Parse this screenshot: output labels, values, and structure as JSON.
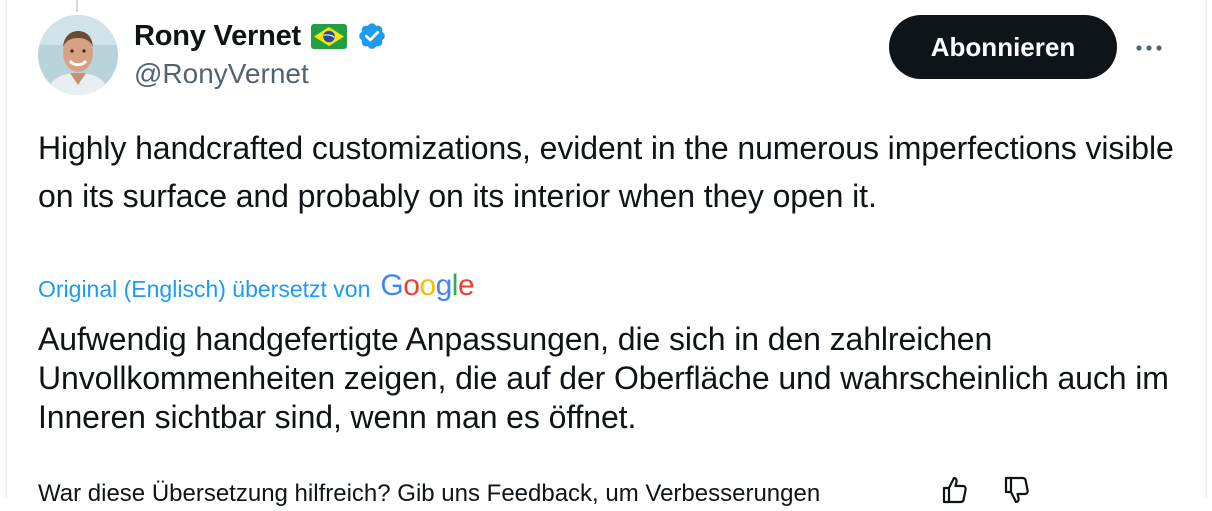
{
  "author": {
    "display_name": "Rony Vernet",
    "handle": "@RonyVernet",
    "avatar_icon": "profile-photo",
    "flag_icon": "brazil-flag-icon",
    "verified_icon": "verified-badge-icon"
  },
  "actions": {
    "follow_label": "Abonnieren",
    "more_icon": "more-horizontal-icon"
  },
  "tweet": {
    "text": "Highly handcrafted customizations, evident in the numerous imperfections visible on its surface and probably on its interior when they open it."
  },
  "translation": {
    "label": "Original (Englisch) übersetzt von",
    "provider_logo": "Google",
    "text": "Aufwendig handgefertigte Anpassungen, die sich in den zahlreichen Unvollkommenheiten zeigen, die auf der Oberfläche und wahrscheinlich auch im Inneren sichtbar sind, wenn man es öffnet."
  },
  "feedback": {
    "prompt": "War diese Übersetzung hilfreich? Gib uns Feedback, um Verbesserungen"
  },
  "colors": {
    "accent": "#1d9bf0",
    "text_primary": "#0f1419",
    "text_secondary": "#536471",
    "button_bg": "#0f1419"
  }
}
